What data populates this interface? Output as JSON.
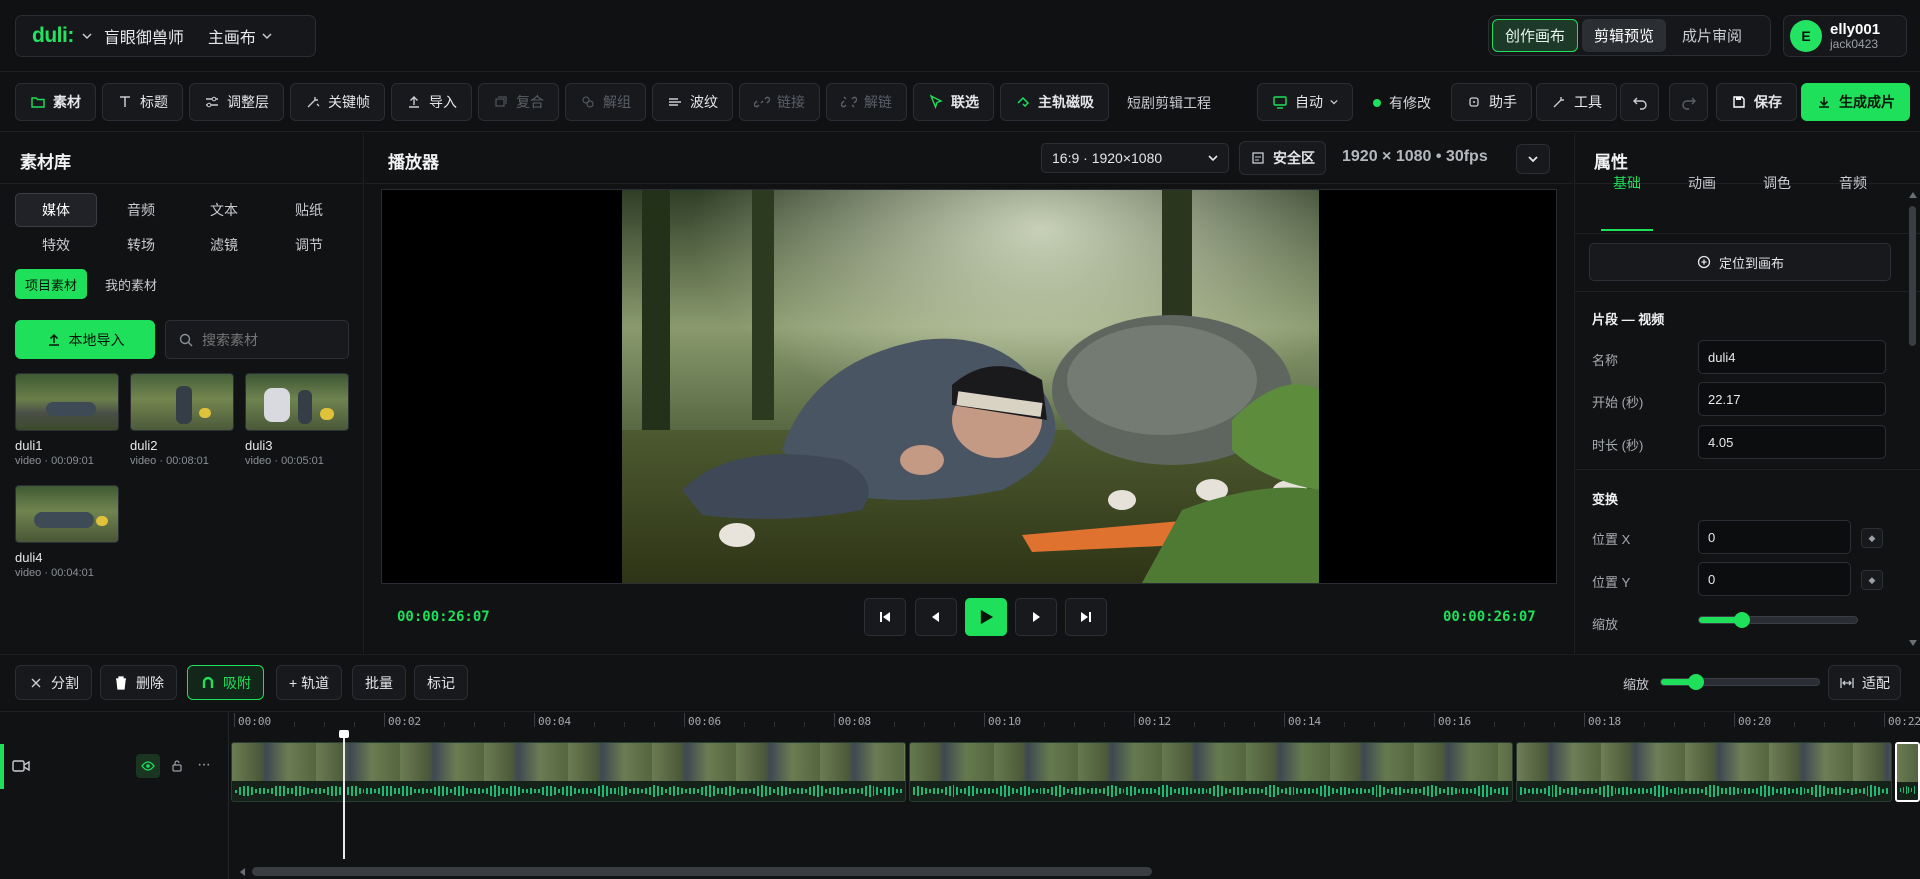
{
  "topbar": {
    "logo": "duli:",
    "project": "盲眼御兽师",
    "canvas": "主画布",
    "modes": [
      "创作画布",
      "剪辑预览",
      "成片审阅"
    ],
    "user": {
      "initial": "E",
      "name": "elly001",
      "sub": "jack0423"
    }
  },
  "toolbar": {
    "material": "素材",
    "title": "标题",
    "adjust": "调整层",
    "keyframe": "关键帧",
    "import": "导入",
    "compound": "复合",
    "ungroup": "解组",
    "ripple": "波纹",
    "link": "链接",
    "unlink": "解链",
    "select": "联选",
    "magnet": "主轨磁吸",
    "project_name": "短剧剪辑工程",
    "auto": "自动",
    "modified": "有修改",
    "assistant": "助手",
    "tools": "工具",
    "save": "保存",
    "export": "生成成片"
  },
  "library": {
    "title": "素材库",
    "categories": [
      "媒体",
      "音频",
      "文本",
      "贴纸",
      "特效",
      "转场",
      "滤镜",
      "调节"
    ],
    "subtabs": [
      "项目素材",
      "我的素材"
    ],
    "import_button": "本地导入",
    "search_placeholder": "搜索素材",
    "items": [
      {
        "name": "duli1",
        "meta": "video · 00:09:01"
      },
      {
        "name": "duli2",
        "meta": "video · 00:08:01"
      },
      {
        "name": "duli3",
        "meta": "video · 00:05:01"
      },
      {
        "name": "duli4",
        "meta": "video · 00:04:01"
      }
    ]
  },
  "player": {
    "title": "播放器",
    "aspect": "16:9 · 1920×1080",
    "safe_zone": "安全区",
    "resolution_info": "1920 × 1080 • 30fps",
    "timecode_left": "00:00:26:07",
    "timecode_right": "00:00:26:07"
  },
  "properties": {
    "title": "属性",
    "tabs": [
      "基础",
      "动画",
      "调色",
      "音频"
    ],
    "locate_button": "定位到画布",
    "section_clip": "片段 — 视频",
    "name_label": "名称",
    "name_value": "duli4",
    "start_label": "开始 (秒)",
    "start_value": "22.17",
    "duration_label": "时长 (秒)",
    "duration_value": "4.05",
    "section_transform": "变换",
    "pos_x_label": "位置 X",
    "pos_x_value": "0",
    "pos_y_label": "位置 Y",
    "pos_y_value": "0",
    "scale_label": "缩放",
    "scale_value": 0.27
  },
  "timeline": {
    "split": "分割",
    "delete": "删除",
    "snap": "吸附",
    "add_track": "+ 轨道",
    "batch": "批量",
    "marker": "标记",
    "zoom_label": "缩放",
    "zoom_value": 0.22,
    "fit": "适配",
    "ruler": [
      "00:00",
      "00:02",
      "00:04",
      "00:06",
      "00:08",
      "00:10",
      "00:12",
      "00:14",
      "00:16",
      "00:18",
      "00:20",
      "00:22"
    ]
  },
  "colors": {
    "accent": "#1ee05a",
    "bg": "#0f1012",
    "panel": "#111214"
  },
  "icons": [
    "folder-icon",
    "text-icon",
    "sliders-icon",
    "keyframe-icon",
    "upload-icon",
    "compound-icon",
    "ungroup-icon",
    "ripple-icon",
    "link-icon",
    "unlink-icon",
    "cursor-icon",
    "magnet-icon",
    "monitor-icon",
    "bot-icon",
    "wand-icon",
    "undo-icon",
    "redo-icon",
    "save-icon",
    "download-icon",
    "search-icon",
    "target-icon",
    "video-icon",
    "eye-icon",
    "lock-icon",
    "more-icon",
    "scissors-icon",
    "trash-icon",
    "fit-icon"
  ]
}
